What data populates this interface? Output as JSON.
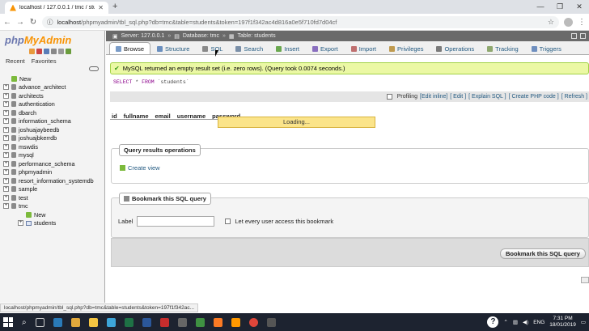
{
  "browser": {
    "tab_title": "localhost / 127.0.0.1 / tmc / stud",
    "url_host": "localhost",
    "url_path": "/phpmyadmin/tbl_sql.php?db=tmc&table=students&token=197f1f342ac4d816a0e5f710fd7d04cf",
    "status_url": "localhost/phpmyadmin/tbl_sql.php?db=tmc&table=students&token=197f1f342ac..."
  },
  "sidebar": {
    "logo_php": "php",
    "logo_my": "MyAdmin",
    "recent": "Recent",
    "favorites": "Favorites",
    "items": [
      {
        "label": "New",
        "kind": "new"
      },
      {
        "label": "advance_architect",
        "kind": "db"
      },
      {
        "label": "architects",
        "kind": "db"
      },
      {
        "label": "authentication",
        "kind": "db"
      },
      {
        "label": "dbarch",
        "kind": "db"
      },
      {
        "label": "information_schema",
        "kind": "db"
      },
      {
        "label": "joshuajaybeedb",
        "kind": "db"
      },
      {
        "label": "joshuajbkerrdb",
        "kind": "db"
      },
      {
        "label": "mswdis",
        "kind": "db"
      },
      {
        "label": "mysql",
        "kind": "db"
      },
      {
        "label": "performance_schema",
        "kind": "db"
      },
      {
        "label": "phpmyadmin",
        "kind": "db"
      },
      {
        "label": "resort_information_systemdb",
        "kind": "db"
      },
      {
        "label": "sample",
        "kind": "db"
      },
      {
        "label": "test",
        "kind": "db"
      },
      {
        "label": "tmc",
        "kind": "db"
      },
      {
        "label": "New",
        "kind": "sub-new"
      },
      {
        "label": "students",
        "kind": "sub-table"
      }
    ]
  },
  "breadcrumb": {
    "server": "Server: 127.0.0.1",
    "database": "Database: tmc",
    "table": "Table: students"
  },
  "tabs": [
    {
      "label": "Browse",
      "active": true,
      "icon": "browse-icon"
    },
    {
      "label": "Structure",
      "active": false,
      "icon": "structure-icon"
    },
    {
      "label": "SQL",
      "active": false,
      "icon": "sql-icon"
    },
    {
      "label": "Search",
      "active": false,
      "icon": "search-icon"
    },
    {
      "label": "Insert",
      "active": false,
      "icon": "insert-icon"
    },
    {
      "label": "Export",
      "active": false,
      "icon": "export-icon"
    },
    {
      "label": "Import",
      "active": false,
      "icon": "import-icon"
    },
    {
      "label": "Privileges",
      "active": false,
      "icon": "privileges-icon"
    },
    {
      "label": "Operations",
      "active": false,
      "icon": "operations-icon"
    },
    {
      "label": "Tracking",
      "active": false,
      "icon": "tracking-icon"
    },
    {
      "label": "Triggers",
      "active": false,
      "icon": "triggers-icon"
    }
  ],
  "result": {
    "message": "MySQL returned an empty result set (i.e. zero rows). (Query took 0.0074 seconds.)",
    "sql_keyword1": "SELECT",
    "sql_star": " * ",
    "sql_keyword2": "FROM",
    "sql_table": " `students`"
  },
  "profiling": {
    "label": "Profiling",
    "links": [
      "[Edit inline]",
      "[ Edit ]",
      "[ Explain SQL ]",
      "[ Create PHP code ]",
      "[ Refresh ]"
    ]
  },
  "columns": [
    "id",
    "fullname",
    "email",
    "username",
    "password"
  ],
  "loading_text": "Loading...",
  "query_ops": {
    "legend": "Query results operations",
    "create_view": "Create view"
  },
  "bookmark": {
    "legend": "Bookmark this SQL query",
    "label": "Label",
    "share_label": "Let every user access this bookmark",
    "submit": "Bookmark this SQL query"
  },
  "taskbar": {
    "language": "ENG",
    "time": "7:31 PM",
    "date": "18/01/2019"
  },
  "colors": {
    "success_bg": "#ebf8a4",
    "loading_bg": "#fbe48a",
    "link": "#235a81",
    "php_blue": "#6c78af",
    "php_orange": "#f89406"
  }
}
